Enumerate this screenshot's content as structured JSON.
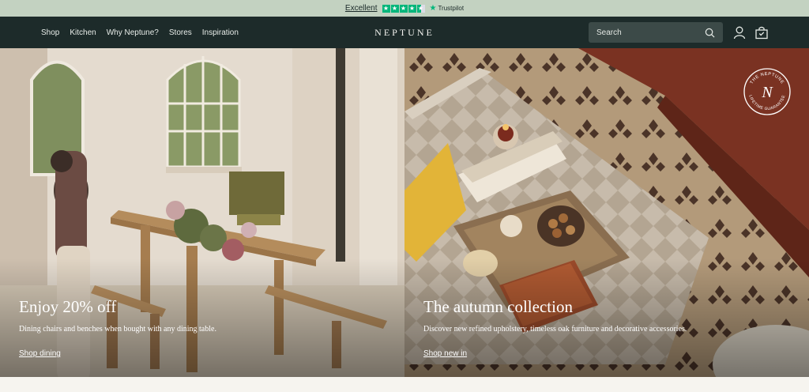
{
  "trustbar": {
    "rating_label": "Excellent",
    "stars": 4.5,
    "star_color": "#00b67a",
    "provider": "Trustpilot"
  },
  "nav": {
    "links": [
      "Shop",
      "Kitchen",
      "Why Neptune?",
      "Stores",
      "Inspiration"
    ],
    "brand": "NEPTUNE",
    "search_placeholder": "Search",
    "icons": [
      "search-icon",
      "account-icon",
      "basket-icon"
    ],
    "bg_color": "#1d2b2a"
  },
  "heroes": [
    {
      "title": "Enjoy 20% off",
      "subtitle": "Dining chairs and benches when bought with any dining table.",
      "link": "Shop dining"
    },
    {
      "title": "The autumn collection",
      "subtitle": "Discover new refined upholstery, timeless oak furniture and decorative accessories.",
      "link": "Shop new in",
      "badge": {
        "top_text": "THE NEPTUNE",
        "bottom_text": "LIFETIME GUARANTEE",
        "letter": "N"
      }
    }
  ]
}
